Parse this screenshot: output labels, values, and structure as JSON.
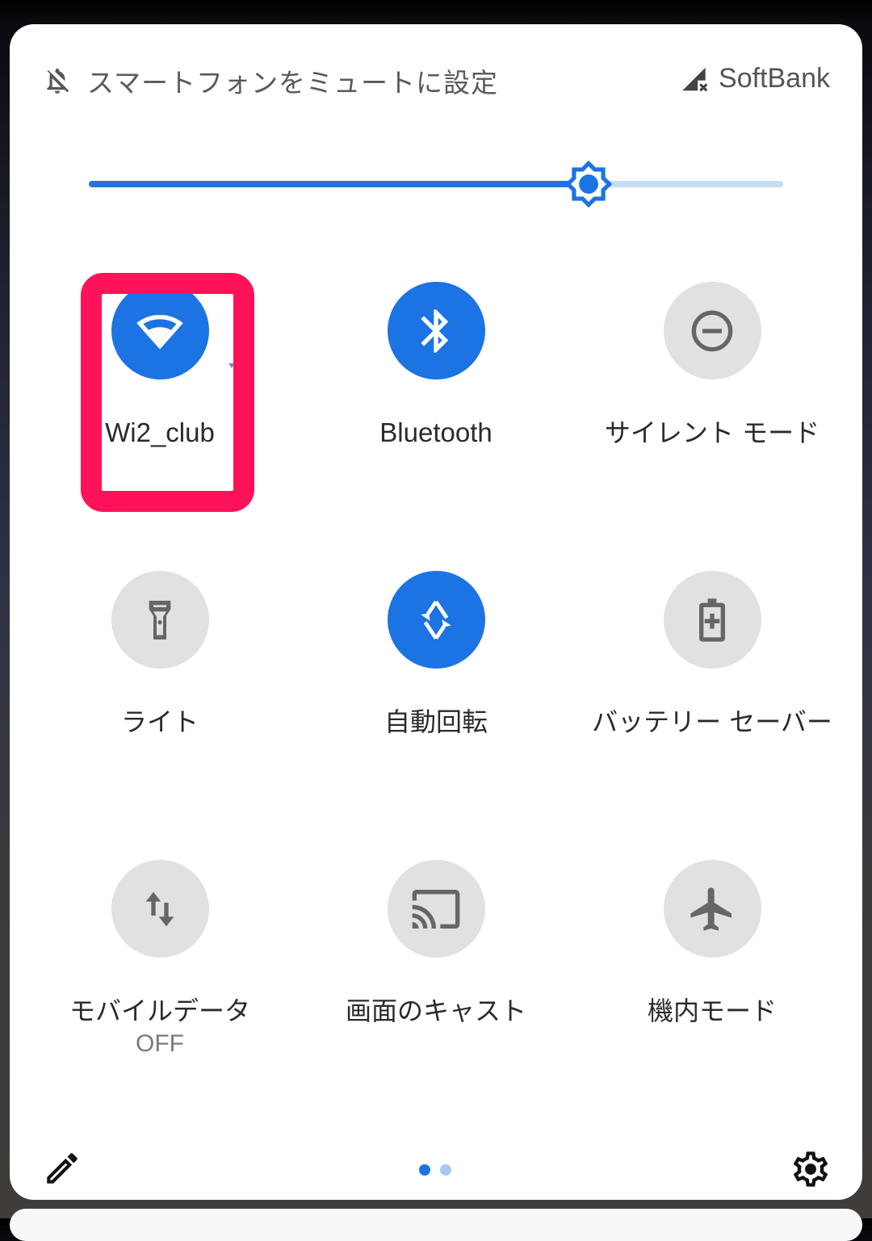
{
  "status": {
    "ringer_text": "スマートフォンをミュートに設定",
    "ringer_icon": "notifications-off-icon",
    "carrier": "SoftBank",
    "signal_icon": "signal-no-connection-icon"
  },
  "brightness": {
    "level_percent": 72,
    "icon": "brightness-icon"
  },
  "tiles": [
    {
      "label": "Wi2_club",
      "state": "on",
      "icon": "wifi-icon",
      "highlighted": true
    },
    {
      "label": "Bluetooth",
      "state": "on",
      "icon": "bluetooth-icon"
    },
    {
      "label": "サイレント モード",
      "state": "off",
      "icon": "do-not-disturb-icon"
    },
    {
      "label": "ライト",
      "state": "off",
      "icon": "flashlight-icon"
    },
    {
      "label": "自動回転",
      "state": "on",
      "icon": "auto-rotate-icon"
    },
    {
      "label": "バッテリー セーバー",
      "state": "off",
      "icon": "battery-saver-icon"
    },
    {
      "label": "モバイルデータ",
      "sublabel": "OFF",
      "state": "off",
      "icon": "mobile-data-icon"
    },
    {
      "label": "画面のキャスト",
      "state": "off",
      "icon": "cast-icon"
    },
    {
      "label": "機内モード",
      "state": "off",
      "icon": "airplane-icon"
    }
  ],
  "footer": {
    "edit_icon": "edit-pencil-icon",
    "settings_icon": "settings-gear-icon",
    "page_count": 2,
    "current_page": 1
  },
  "colors": {
    "accent": "#1c73e3",
    "tile_off": "#e1e1e1",
    "highlight": "#ff1258"
  }
}
